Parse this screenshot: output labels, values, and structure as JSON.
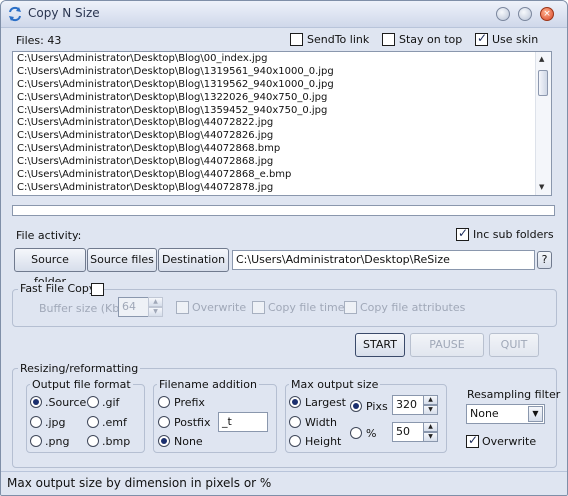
{
  "window": {
    "title": "Copy N Size",
    "close_glyph": "×"
  },
  "top": {
    "files_count": "Files: 43",
    "sendto_link": {
      "label": "SendTo link",
      "checked": false
    },
    "stay_on_top": {
      "label": "Stay on top",
      "checked": false
    },
    "use_skin": {
      "label": "Use skin",
      "checked": true
    }
  },
  "files": [
    "C:\\Users\\Administrator\\Desktop\\Blog\\00_index.jpg",
    "C:\\Users\\Administrator\\Desktop\\Blog\\1319561_940x1000_0.jpg",
    "C:\\Users\\Administrator\\Desktop\\Blog\\1319562_940x1000_0.jpg",
    "C:\\Users\\Administrator\\Desktop\\Blog\\1322026_940x750_0.jpg",
    "C:\\Users\\Administrator\\Desktop\\Blog\\1359452_940x750_0.jpg",
    "C:\\Users\\Administrator\\Desktop\\Blog\\44072822.jpg",
    "C:\\Users\\Administrator\\Desktop\\Blog\\44072826.jpg",
    "C:\\Users\\Administrator\\Desktop\\Blog\\44072868.bmp",
    "C:\\Users\\Administrator\\Desktop\\Blog\\44072868.jpg",
    "C:\\Users\\Administrator\\Desktop\\Blog\\44072868_e.bmp",
    "C:\\Users\\Administrator\\Desktop\\Blog\\44072878.jpg"
  ],
  "activity": {
    "label": "File activity:",
    "inc_sub_folders": {
      "label": "Inc sub folders",
      "checked": true
    },
    "source_folder": "Source folder",
    "source_files": "Source files",
    "destination": "Destination",
    "destination_path": "C:\\Users\\Administrator\\Desktop\\ReSize",
    "help": "?"
  },
  "fast_copy": {
    "title": "Fast File Copy",
    "checked": false,
    "buffer_label": "Buffer size (Kb)",
    "buffer_value": "64",
    "overwrite": "Overwrite",
    "copy_file_times": "Copy file times",
    "copy_file_attributes": "Copy file attributes"
  },
  "actions": {
    "start": "START",
    "pause": "PAUSE",
    "quit": "QUIT"
  },
  "resize": {
    "title": "Resizing/reformatting",
    "output_format": {
      "title": "Output file format",
      "source": ".Source",
      "gif": ".gif",
      "jpg": ".jpg",
      "emf": ".emf",
      "png": ".png",
      "bmp": ".bmp",
      "selected": ".Source"
    },
    "filename": {
      "title": "Filename addition",
      "prefix": "Prefix",
      "postfix": "Postfix",
      "none": "None",
      "postfix_value": "_t",
      "selected": "None"
    },
    "max_size": {
      "title": "Max output size",
      "largest": "Largest",
      "width": "Width",
      "height": "Height",
      "pixs": "Pixs",
      "percent": "%",
      "pixs_value": "320",
      "percent_value": "50",
      "selected_dimension": "Largest",
      "selected_unit": "Pixs"
    },
    "resampling": {
      "title": "Resampling filter",
      "selected": "None",
      "overwrite": {
        "label": "Overwrite",
        "checked": true
      }
    }
  },
  "status_bar": "Max output size by dimension in pixels or %",
  "colors": {
    "window_bg": "#dfe5f1",
    "titlebar_close": "#d9472a",
    "selection_dot": "#1b2f6e"
  }
}
